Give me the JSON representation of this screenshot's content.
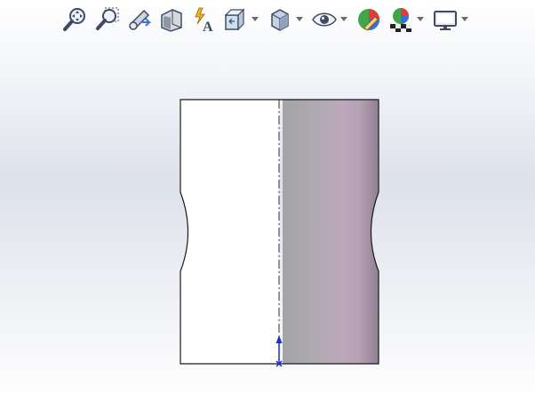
{
  "toolbar": {
    "items": [
      {
        "name": "zoom-to-fit-icon",
        "has_dropdown": false
      },
      {
        "name": "zoom-to-area-icon",
        "has_dropdown": false
      },
      {
        "name": "previous-view-icon",
        "has_dropdown": false
      },
      {
        "name": "section-view-icon",
        "has_dropdown": false
      },
      {
        "name": "dynamic-annotation-views-icon",
        "has_dropdown": false
      },
      {
        "name": "view-orientation-icon",
        "has_dropdown": true
      },
      {
        "name": "display-style-icon",
        "has_dropdown": true
      },
      {
        "name": "hide-show-items-icon",
        "has_dropdown": true
      },
      {
        "name": "edit-appearance-icon",
        "has_dropdown": false
      },
      {
        "name": "apply-scene-icon",
        "has_dropdown": true
      },
      {
        "name": "view-settings-icon",
        "has_dropdown": true
      }
    ]
  },
  "model": {
    "view": "front",
    "left_half_fill": "#ffffff",
    "shaded_gradient": [
      "#a4a4a6",
      "#aeaab0",
      "#bca8bd",
      "#b7a1b6",
      "#8c8090"
    ],
    "outline_color": "#1a1a1a",
    "centerline_color": "#333333",
    "origin_arrow_color": "#1a2fd0"
  }
}
